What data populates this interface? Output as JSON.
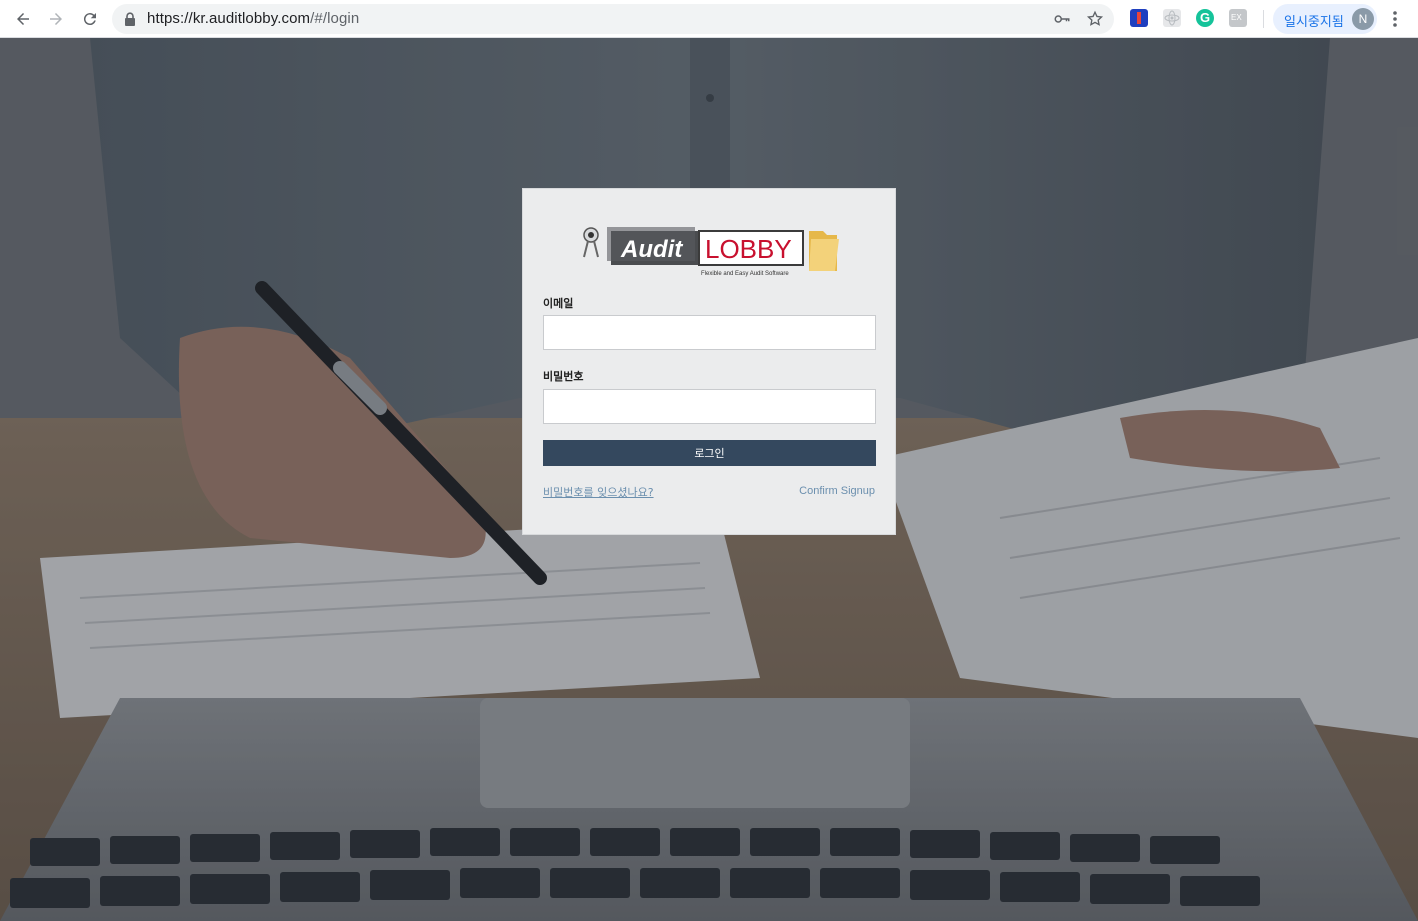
{
  "browser": {
    "url_host": "https://kr.auditlobby.com",
    "url_path": "/#/login",
    "profile_label": "일시중지됨",
    "profile_initial": "N",
    "extensions": [
      "password-key-icon",
      "bookmark-star-icon",
      "extension-tag-icon",
      "extension-react-icon",
      "grammarly-icon",
      "extension-ex-icon"
    ]
  },
  "login": {
    "logo_audit": "Audit",
    "logo_lobby": "LOBBY",
    "logo_tagline": "Flexible and Easy Audit Software",
    "email_label": "이메일",
    "email_value": "",
    "password_label": "비밀번호",
    "password_value": "",
    "login_button": "로그인",
    "forgot_password": "비밀번호를 잊으셨나요?",
    "confirm_signup": "Confirm Signup"
  },
  "colors": {
    "button_bg": "#34485e",
    "link": "#6b8fae",
    "logo_red": "#c8102e",
    "logo_dark": "#3b3b3b",
    "card_bg": "#ebeced"
  }
}
